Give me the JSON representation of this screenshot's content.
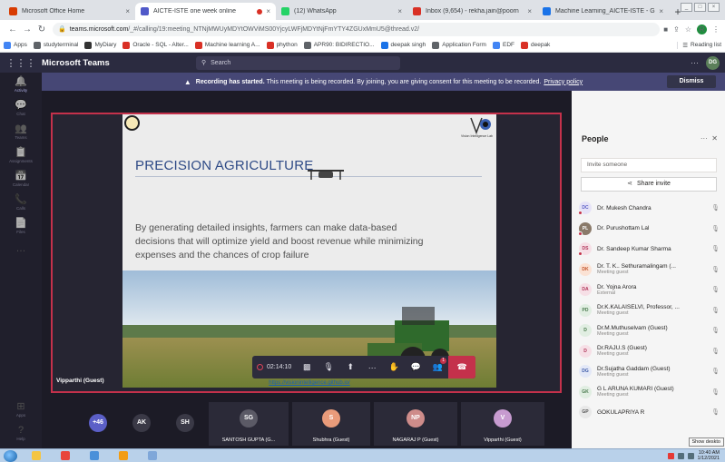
{
  "browser": {
    "tabs": [
      {
        "title": "Microsoft Office Home",
        "color": "#d83b01",
        "active": false
      },
      {
        "title": "AICTE-ISTE one week online",
        "color": "#5059c9",
        "active": true,
        "recording": true
      },
      {
        "title": "(12) WhatsApp",
        "color": "#25d366",
        "active": false
      },
      {
        "title": "Inbox (9,654) - rekha.jain@poorn",
        "color": "#d93025",
        "active": false
      },
      {
        "title": "Machine Learning_AICTE-ISTE - G",
        "color": "#1a73e8",
        "active": false
      }
    ],
    "url_host": "teams.microsoft.com",
    "url_path": "/_#/calling/19:meeting_NTNjMWUyMDYtOWViMS00YjcyLWFjMDYtNjFmYTY4ZGUxMmU5@thread.v2/",
    "profile_initial": "R",
    "bookmarks": [
      "Apps",
      "studyterminal",
      "MyDiary",
      "Oracle - SQL - Alter...",
      "Machine learning A...",
      "phython",
      "APR90: BIDIRECTIO...",
      "deepak singh",
      "Application Form",
      "EDF",
      "deepak"
    ],
    "bookmark_colors": [
      "#4285f4",
      "#5f6368",
      "#333333",
      "#d93025",
      "#d93025",
      "#d93025",
      "#5f6368",
      "#1a73e8",
      "#5f6368",
      "#4285f4",
      "#d93025"
    ],
    "reading_list": "Reading list"
  },
  "teams": {
    "app_name": "Microsoft Teams",
    "search_placeholder": "Search",
    "me_initials": "DG",
    "rail": [
      {
        "label": "Activity",
        "icon": "bell-icon",
        "glyph": "🔔"
      },
      {
        "label": "Chat",
        "icon": "chat-icon",
        "glyph": "💬"
      },
      {
        "label": "Teams",
        "icon": "teams-icon",
        "glyph": "👥"
      },
      {
        "label": "Assignments",
        "icon": "assignments-icon",
        "glyph": "📋"
      },
      {
        "label": "Calendar",
        "icon": "calendar-icon",
        "glyph": "📅"
      },
      {
        "label": "Calls",
        "icon": "phone-icon",
        "glyph": "📞"
      },
      {
        "label": "Files",
        "icon": "files-icon",
        "glyph": "📄"
      },
      {
        "label": "",
        "icon": "more-icon",
        "glyph": "…"
      }
    ],
    "rail_bottom": [
      {
        "label": "Apps",
        "icon": "apps-icon",
        "glyph": "⊞"
      },
      {
        "label": "Help",
        "icon": "help-icon",
        "glyph": "?"
      }
    ],
    "banner": {
      "bold": "Recording has started.",
      "text": "This meeting is being recorded. By joining, you are giving consent for this meeting to be recorded.",
      "link": "Privacy policy",
      "dismiss": "Dismiss"
    }
  },
  "slide": {
    "title": "PRECISION AGRICULTURE",
    "body": "By generating detailed insights, farmers can make data-based decisions that will optimize yield and boost revenue while minimizing expenses and the chances of crop failure",
    "logo_text": "Vision Intelligence Lab",
    "link": "https://visionintelligence.github.io/"
  },
  "presenter": "Vipparthi (Guest)",
  "call": {
    "timer": "02:14:10",
    "participant_badge": "1"
  },
  "strip": [
    {
      "initials": "+46",
      "color": "#5b5fc7",
      "name": ""
    },
    {
      "initials": "AK",
      "color": "#3a3946",
      "name": ""
    },
    {
      "initials": "SH",
      "color": "#3a3946",
      "name": ""
    },
    {
      "initials": "SG",
      "color": "#5b5a66",
      "name": "SANTOSH GUPTA (G..."
    },
    {
      "initials": "S",
      "color": "#e99b7a",
      "name": "Shubhra (Guest)"
    },
    {
      "initials": "NP",
      "color": "#ce8c8a",
      "name": "NAGARAJ P (Guest)"
    },
    {
      "initials": "V",
      "color": "#c79bd0",
      "name": "Vipparthi (Guest)"
    }
  ],
  "people": {
    "heading": "People",
    "invite_placeholder": "Invite someone",
    "share_invite": "Share invite",
    "list": [
      {
        "initials": "DC",
        "bg": "#e6e3f7",
        "fg": "#5b5fc7",
        "name": "Dr. Mukesh Chandra",
        "sub": "",
        "dot": true
      },
      {
        "initials": "PL",
        "bg": "#8a7a6a",
        "fg": "#ffffff",
        "name": "Dr. Purushottam Lal",
        "sub": "",
        "dot": true
      },
      {
        "initials": "DS",
        "bg": "#f6dfe6",
        "fg": "#b1365a",
        "name": "Dr. Sandeep Kumar Sharma",
        "sub": "",
        "dot": true
      },
      {
        "initials": "DK",
        "bg": "#fbe2d4",
        "fg": "#c4542b",
        "name": "Dr. T. K.. Sethuramalingam (...",
        "sub": "Meeting guest",
        "dot": false
      },
      {
        "initials": "DA",
        "bg": "#f6dfe6",
        "fg": "#b1365a",
        "name": "Dr. Yojna Arora",
        "sub": "External",
        "dot": false
      },
      {
        "initials": "PD",
        "bg": "#e1eee2",
        "fg": "#4a7a4e",
        "name": "Dr.K.KALAISELVI, Professor, ...",
        "sub": "Meeting guest",
        "dot": false
      },
      {
        "initials": "D",
        "bg": "#e1eee2",
        "fg": "#4a7a4e",
        "name": "Dr.M.Muthuselvam (Guest)",
        "sub": "Meeting guest",
        "dot": false
      },
      {
        "initials": "D",
        "bg": "#f6dfe6",
        "fg": "#b1365a",
        "name": "Dr.RAJU.S (Guest)",
        "sub": "Meeting guest",
        "dot": false
      },
      {
        "initials": "DG",
        "bg": "#e3e8f7",
        "fg": "#3d5ba9",
        "name": "Dr.Sujatha Gaddam (Guest)",
        "sub": "Meeting guest",
        "dot": false
      },
      {
        "initials": "GK",
        "bg": "#e1eee2",
        "fg": "#4a7a4e",
        "name": "G L ARUNA KUMARI (Guest)",
        "sub": "Meeting guest",
        "dot": false
      },
      {
        "initials": "GP",
        "bg": "#e8e8e8",
        "fg": "#555555",
        "name": "GOKULAPRIYA R",
        "sub": "",
        "dot": false
      }
    ],
    "tooltip": "Show deskto"
  },
  "taskbar": {
    "time": "10:40 AM",
    "date": "1/12/2021",
    "apps": [
      "#f5c542",
      "#e8453c",
      "#4a90d9",
      "#f39c12",
      "#7fa7d9"
    ]
  }
}
